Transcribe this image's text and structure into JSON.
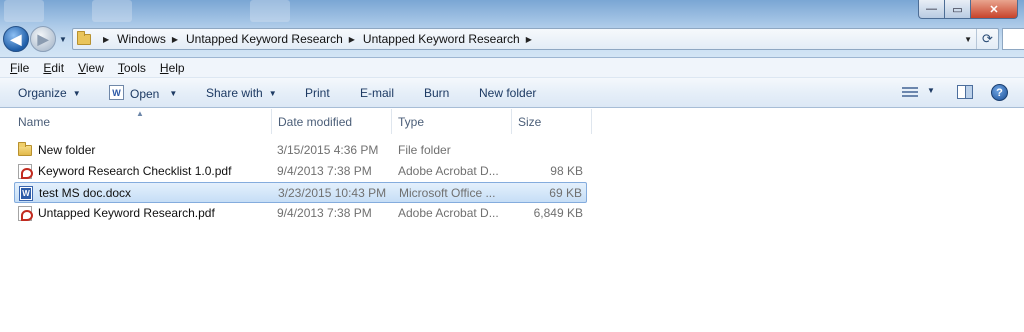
{
  "window": {
    "minimize_glyph": "—",
    "maximize_glyph": "▭",
    "close_glyph": "✕"
  },
  "address_bar": {
    "crumbs": [
      "Windows",
      "Untapped Keyword Research",
      "Untapped Keyword Research"
    ]
  },
  "menu": {
    "items": [
      {
        "key": "F",
        "rest": "ile"
      },
      {
        "key": "E",
        "rest": "dit"
      },
      {
        "key": "V",
        "rest": "iew"
      },
      {
        "key": "T",
        "rest": "ools"
      },
      {
        "key": "H",
        "rest": "elp"
      }
    ]
  },
  "toolbar": {
    "organize": "Organize",
    "open": "Open",
    "open_icon": "W",
    "share_with": "Share with",
    "print": "Print",
    "email": "E-mail",
    "burn": "Burn",
    "new_folder": "New folder",
    "help_glyph": "?"
  },
  "columns": {
    "name": "Name",
    "date": "Date modified",
    "type": "Type",
    "size": "Size"
  },
  "files": [
    {
      "name": "New folder",
      "date": "3/15/2015 4:36 PM",
      "type": "File folder",
      "size": "",
      "icon": "folder-icon",
      "selected": false
    },
    {
      "name": "Keyword Research Checklist 1.0.pdf",
      "date": "9/4/2013 7:38 PM",
      "type": "Adobe Acrobat D...",
      "size": "98 KB",
      "icon": "pdf-icon",
      "selected": false
    },
    {
      "name": "test MS doc.docx",
      "date": "3/23/2015 10:43 PM",
      "type": "Microsoft Office ...",
      "size": "69 KB",
      "icon": "word-doc-icon",
      "selected": true
    },
    {
      "name": "Untapped Keyword Research.pdf",
      "date": "9/4/2013 7:38 PM",
      "type": "Adobe Acrobat D...",
      "size": "6,849 KB",
      "icon": "pdf-icon",
      "selected": false
    }
  ],
  "colors": {
    "selection_fill": "#c6def6",
    "selection_border": "#84acdd",
    "toolbar_text": "#1d3a63",
    "muted_text": "#707070"
  }
}
